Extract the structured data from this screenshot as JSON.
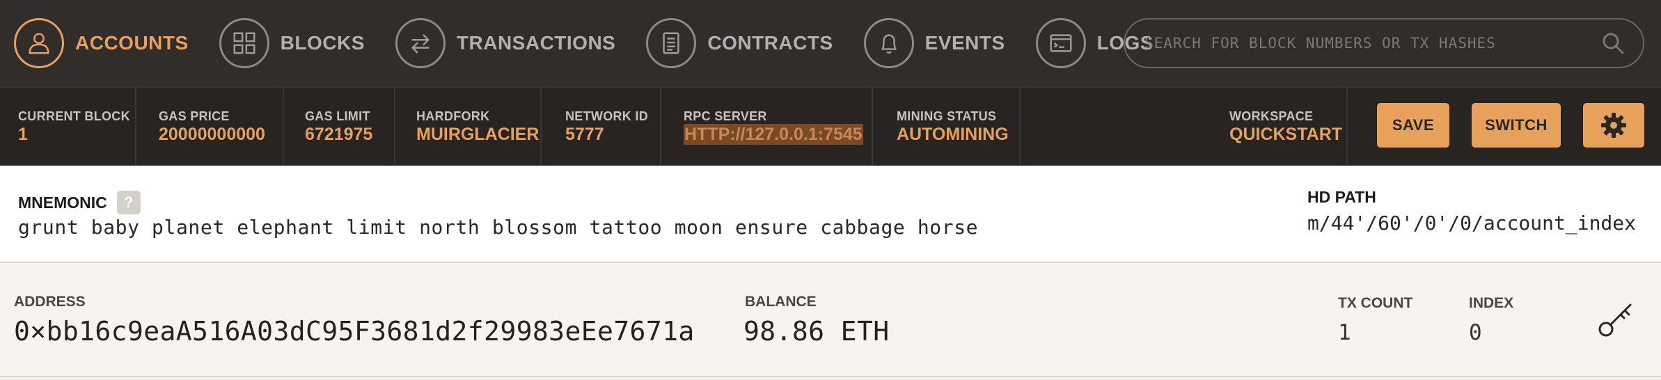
{
  "nav": {
    "items": [
      {
        "label": "ACCOUNTS",
        "icon": "user-icon",
        "active": true
      },
      {
        "label": "BLOCKS",
        "icon": "grid-icon",
        "active": false
      },
      {
        "label": "TRANSACTIONS",
        "icon": "arrows-swap-icon",
        "active": false
      },
      {
        "label": "CONTRACTS",
        "icon": "document-icon",
        "active": false
      },
      {
        "label": "EVENTS",
        "icon": "bell-icon",
        "active": false
      },
      {
        "label": "LOGS",
        "icon": "terminal-icon",
        "active": false
      }
    ],
    "search_placeholder": "SEARCH FOR BLOCK NUMBERS OR TX HASHES"
  },
  "status": {
    "current_block_label": "CURRENT BLOCK",
    "current_block": "1",
    "gas_price_label": "GAS PRICE",
    "gas_price": "20000000000",
    "gas_limit_label": "GAS LIMIT",
    "gas_limit": "6721975",
    "hardfork_label": "HARDFORK",
    "hardfork": "MUIRGLACIER",
    "network_id_label": "NETWORK ID",
    "network_id": "5777",
    "rpc_label": "RPC SERVER",
    "rpc": "HTTP://127.0.0.1:7545",
    "mining_label": "MINING STATUS",
    "mining": "AUTOMINING",
    "workspace_label": "WORKSPACE",
    "workspace": "QUICKSTART",
    "save_label": "SAVE",
    "switch_label": "SWITCH"
  },
  "mnemonic": {
    "label": "MNEMONIC",
    "help": "?",
    "words": "grunt baby planet elephant limit north blossom tattoo moon ensure cabbage horse",
    "hd_path_label": "HD PATH",
    "hd_path": "m/44'/60'/0'/0/account_index"
  },
  "account": {
    "address_label": "ADDRESS",
    "address": "0×bb16c9eaA516A03dC95F3681d2f29983eEe7671a",
    "balance_label": "BALANCE",
    "balance": "98.86 ETH",
    "tx_count_label": "TX COUNT",
    "tx_count": "1",
    "index_label": "INDEX",
    "index": "0"
  },
  "colors": {
    "accent": "#e8a15a",
    "nav_bg": "#302d2a",
    "status_bg": "#272422"
  }
}
